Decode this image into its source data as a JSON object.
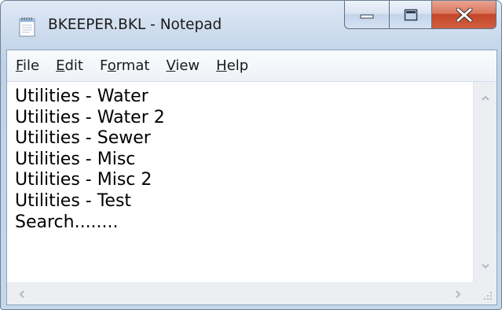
{
  "window": {
    "title": "BKEEPER.BKL - Notepad",
    "colors": {
      "close_button": "#c4452a",
      "frame": "#c9d9ec"
    }
  },
  "menubar": {
    "items": [
      {
        "mnemonic": "F",
        "rest": "ile"
      },
      {
        "mnemonic": "E",
        "rest": "dit"
      },
      {
        "prefix": "F",
        "mnemonic": "o",
        "rest": "rmat"
      },
      {
        "mnemonic": "V",
        "rest": "iew"
      },
      {
        "mnemonic": "H",
        "rest": "elp"
      }
    ]
  },
  "editor": {
    "lines": [
      "Utilities - Water",
      "Utilities - Water 2",
      "Utilities - Sewer",
      "Utilities - Misc",
      "Utilities - Misc 2",
      "Utilities - Test",
      "Search........"
    ]
  },
  "icons": {
    "app": "notepad-icon",
    "minimize": "minimize-icon",
    "maximize": "maximize-icon",
    "close": "close-icon",
    "scroll_up": "arrow-up-icon",
    "scroll_down": "arrow-down-icon",
    "scroll_left": "arrow-left-icon",
    "scroll_right": "arrow-right-icon",
    "grip": "size-grip-icon"
  }
}
